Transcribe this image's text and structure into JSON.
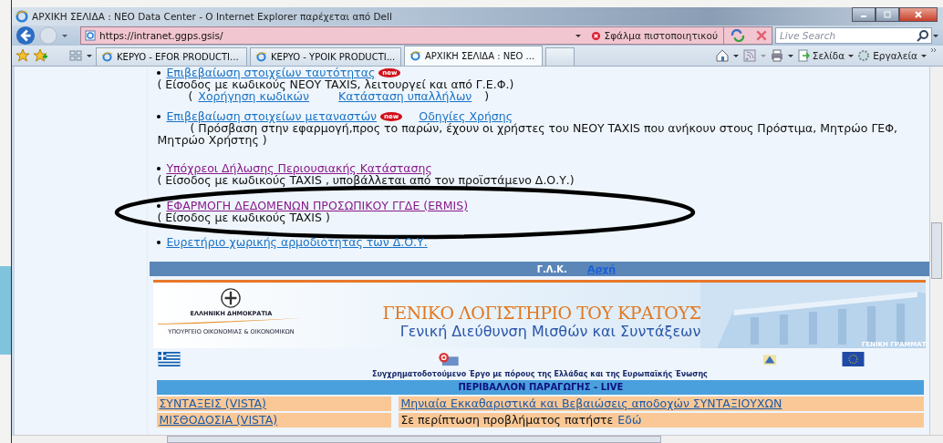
{
  "window": {
    "title": "ΑΡΧΙΚΗ ΣΕΛΙΔΑ : NEO Data Center - Ο Internet Explorer παρέχεται από Dell"
  },
  "address_bar": {
    "url": "https://intranet.ggps.gsis/",
    "certificate_error": "Σφάλμα πιστοποιητικού"
  },
  "search": {
    "placeholder": "Live Search"
  },
  "tabs": [
    {
      "label": "KEPYO - EFOR PRODUCTI...",
      "selected": false
    },
    {
      "label": "KEPYO - YPOIK PRODUCTI...",
      "selected": false
    },
    {
      "label": "ΑΡΧΙΚΗ ΣΕΛΙΔΑ : NEO ...",
      "selected": true
    }
  ],
  "command_bar": [
    "Σελίδα",
    "Εργαλεία"
  ],
  "services": [
    {
      "link": "Επιβεβαίωση στοιχείων ταυτότητας",
      "visited": false,
      "badge": "new",
      "note": "( Είσοδος με κωδικούς ΝΕΟΥ TAXIS, λειτουργεί και από Γ.Ε.Φ.)",
      "sublinks_open": "(",
      "sublinks": [
        "Χορήγηση κωδικών",
        "Κατάσταση υπαλλήλων"
      ],
      "sublinks_close": ")"
    },
    {
      "link": "Επιβεβαίωση στοιχείων μεταναστών",
      "visited": false,
      "badge": "new",
      "extra_link": "Οδηγίες Χρήσης",
      "note": "( Πρόσβαση στην εφαρμογή,προς το παρών, έχουν οι χρήστες του ΝΕΟΥ TAXIS που ανήκουν στους Πρόστιμα, Μητρώο ΓΕΦ, Μητρώο Χρήστης )"
    },
    {
      "link": "Υπόχρεοι Δήλωσης Περιουσιακής Κατάστασης",
      "visited": true,
      "note": "( Είσοδος με κωδικούς TAXIS , υποβάλλεται από τον προϊστάμενο Δ.Ο.Υ.)"
    },
    {
      "link": "ΕΦΑΡΜΟΓΗ ΔΕΔΟΜΕΝΩΝ ΠΡΟΣΩΠΙΚΟΥ ΓΓΔΕ (ERMIS)",
      "visited": true,
      "circled": true,
      "note": "( Είσοδος με κωδικούς TAXIS )"
    },
    {
      "link": "Ευρετήριο χωρικής αρμοδιότητας των Δ.Ο.Υ.",
      "visited": false,
      "circled": false
    }
  ],
  "nav_bar": {
    "label": "Γ.Λ.Κ.",
    "link": "Αρχή"
  },
  "banner": {
    "republic": "ΕΛΛΗΝΙΚΗ ΔΗΜΟΚΡΑΤΙΑ",
    "ministry": "ΥΠΟΥΡΓΕΙΟ ΟΙΚΟΝΟΜΙΑΣ & ΟΙΚΟΝΟΜΙΚΩΝ",
    "title": "ΓΕΝΙΚΟ ΛΟΓΙΣΤΗΡΙΟ ΤΟΥ ΚΡΑΤΟΥΣ",
    "subtitle": "Γενική Διεύθυνση Μισθών και Συντάξεων",
    "corner": "ΓΕΝΙΚΗ ΓΡΑΜΜΑΤ"
  },
  "cofunding": "Συγχρηματοδοτούμενο Έργο με πόρους της Ελλάδας και της Ευρωπαϊκής Ένωσης",
  "table": {
    "header": "ΠΕΡΙΒΑΛΛΟΝ ΠΑΡΑΓΩΓΗΣ - LIVE",
    "rows": [
      [
        {
          "kind": "link",
          "text": "ΣΥΝΤΑΞΕΙΣ (VISTA)"
        },
        {
          "kind": "link",
          "text": "Μηνιαία Εκκαθαριστικά και Βεβαιώσεις αποδοχών ΣΥΝΤΑΞΙΟΥΧΩΝ"
        }
      ],
      [
        {
          "kind": "link",
          "text": "ΜΙΣΘΟΔΟΣΙΑ (VISTA)"
        },
        {
          "kind": "text_link",
          "text": "Σε περίπτωση προβλήματος πατήστε",
          "link": "Εδώ"
        }
      ]
    ]
  }
}
